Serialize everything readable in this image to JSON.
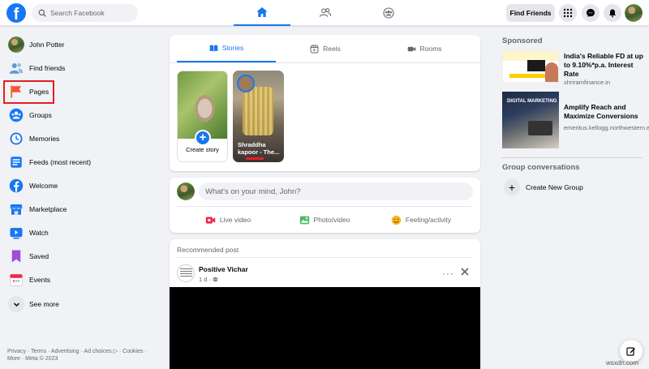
{
  "topbar": {
    "logo": "f",
    "search_placeholder": "Search Facebook",
    "find_friends": "Find Friends"
  },
  "sidebar": {
    "items": [
      {
        "label": "John Potter",
        "icon": "avatar"
      },
      {
        "label": "Find friends",
        "icon": "friends-icon"
      },
      {
        "label": "Pages",
        "icon": "flag-icon"
      },
      {
        "label": "Groups",
        "icon": "groups-icon"
      },
      {
        "label": "Memories",
        "icon": "clock-icon"
      },
      {
        "label": "Feeds (most recent)",
        "icon": "feeds-icon"
      },
      {
        "label": "Welcome",
        "icon": "facebook-icon"
      },
      {
        "label": "Marketplace",
        "icon": "store-icon"
      },
      {
        "label": "Watch",
        "icon": "video-icon"
      },
      {
        "label": "Saved",
        "icon": "bookmark-icon"
      },
      {
        "label": "Events",
        "icon": "calendar-icon"
      },
      {
        "label": "See more",
        "icon": "chevron-down-icon"
      }
    ],
    "footer": "Privacy · Terms · Advertising · Ad choices ▷ · Cookies · More · Meta © 2023"
  },
  "stories": {
    "tabs": [
      "Stories",
      "Reels",
      "Rooms"
    ],
    "create_label": "Create story",
    "friend_story_name": "Shraddha kapoor - The..."
  },
  "composer": {
    "placeholder": "What's on your mind, John?",
    "actions": [
      "Live video",
      "Photo/video",
      "Feeling/activity"
    ]
  },
  "post": {
    "section_label": "Recommended post",
    "author": "Positive Vichar",
    "time": "1 d ·",
    "more": "···"
  },
  "right": {
    "sponsored_label": "Sponsored",
    "ads": [
      {
        "title": "India's Reliable FD at up to 9.10%*p.a. Interest Rate",
        "url": "shriramfinance.in"
      },
      {
        "title": "Amplify Reach and Maximize Conversions",
        "url": "emeritus.kellogg.northwestern.edu"
      }
    ],
    "ad2_image_text": "DIGITAL MARKETING",
    "group_label": "Group conversations",
    "create_group": "Create New Group"
  },
  "watermark": "wsxdn.com",
  "colors": {
    "brand": "#1877f2",
    "highlight": "#e41e26"
  }
}
